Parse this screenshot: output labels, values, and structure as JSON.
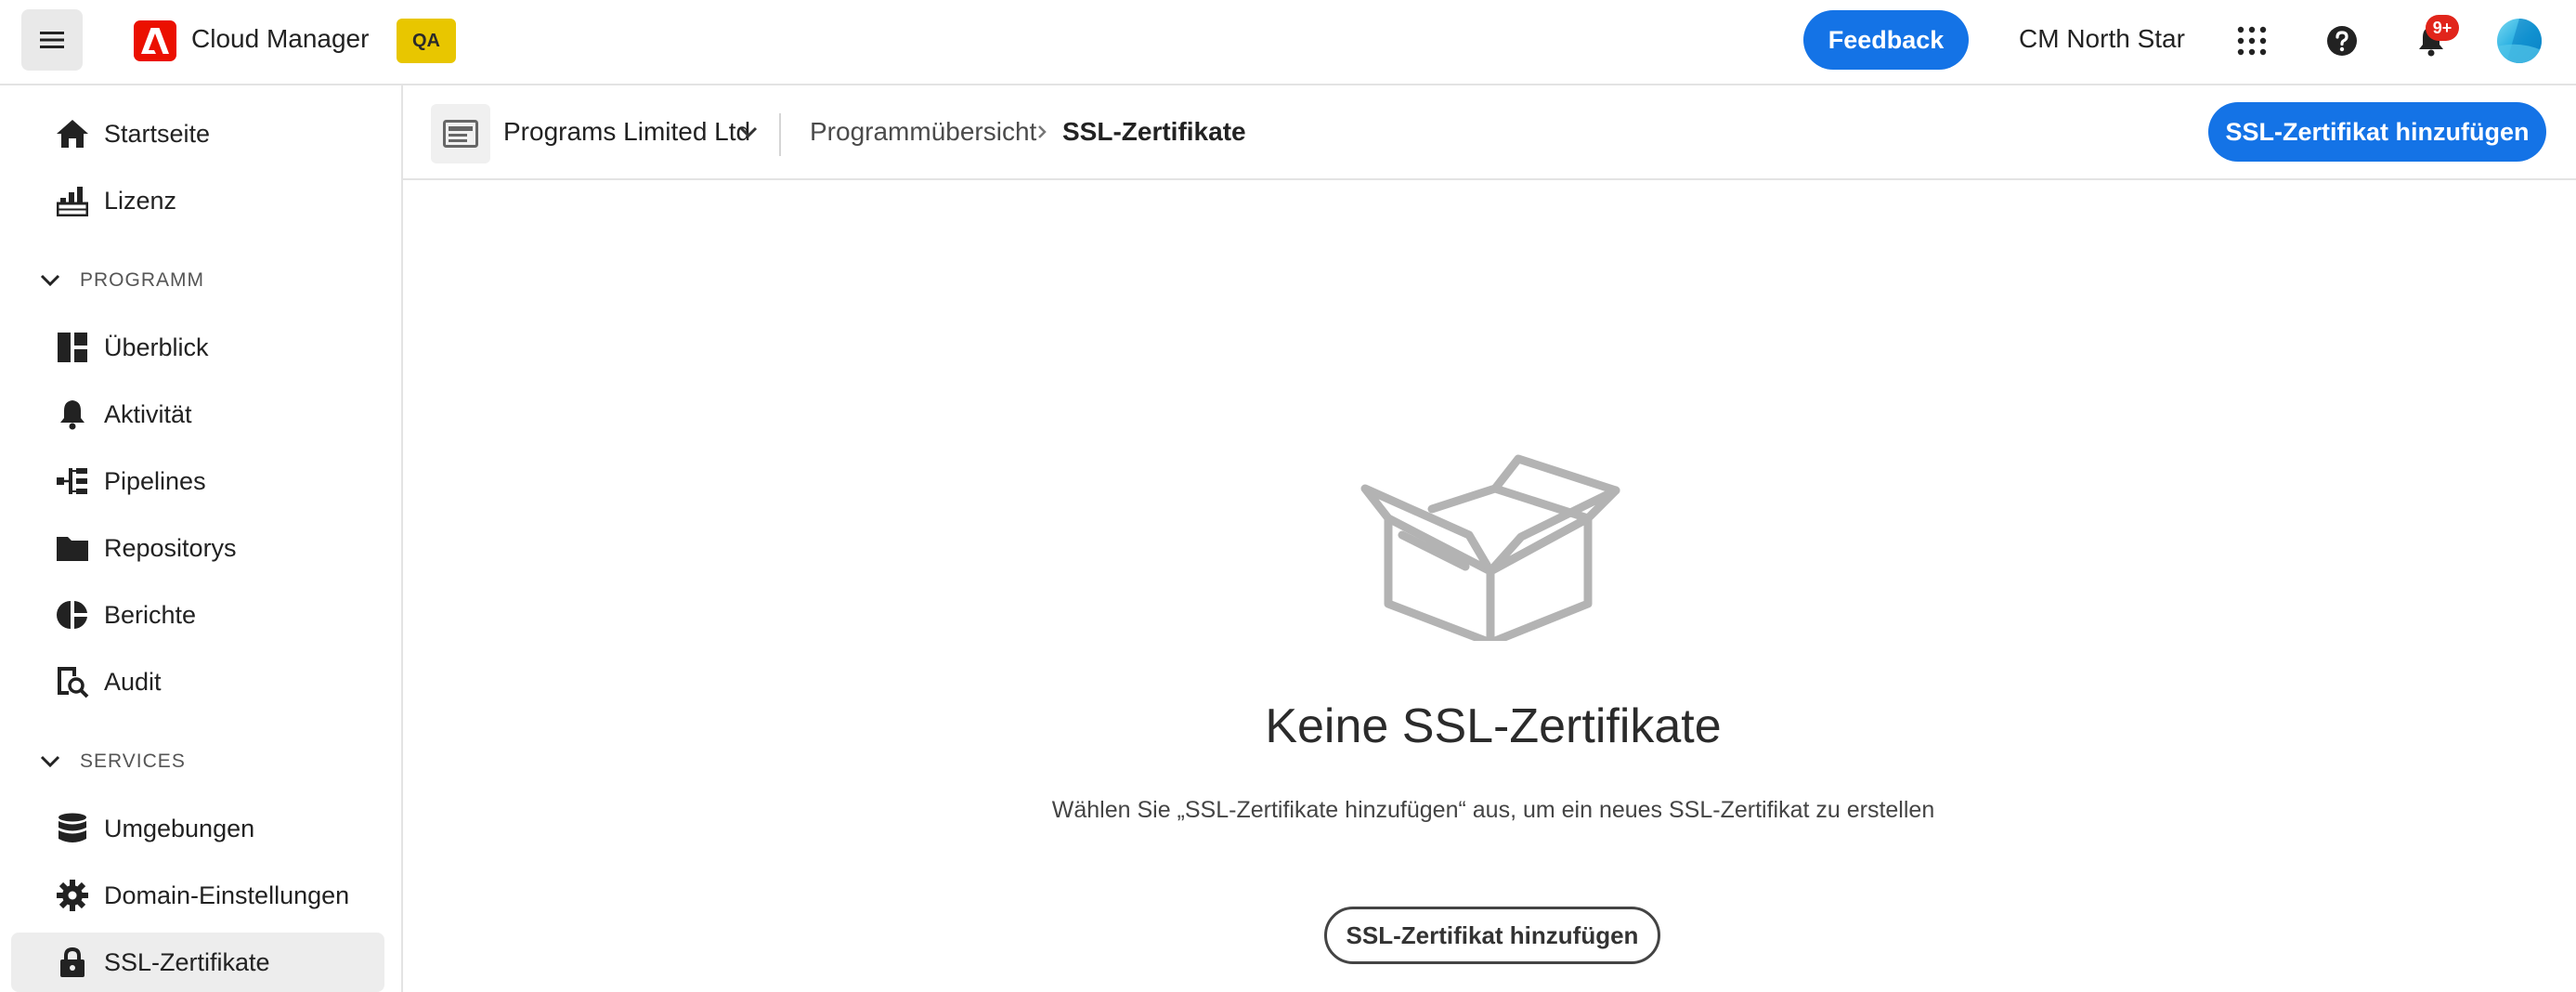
{
  "header": {
    "app_name": "Cloud Manager",
    "env_badge": "QA",
    "feedback_label": "Feedback",
    "org_name": "CM North Star",
    "notification_count": "9+"
  },
  "sidebar": {
    "top_items": [
      {
        "label": "Startseite",
        "icon": "home-icon"
      },
      {
        "label": "Lizenz",
        "icon": "license-chart-icon"
      }
    ],
    "program_section": {
      "label": "PROGRAMM",
      "items": [
        {
          "label": "Überblick",
          "icon": "dashboard-icon"
        },
        {
          "label": "Aktivität",
          "icon": "bell-icon"
        },
        {
          "label": "Pipelines",
          "icon": "pipeline-icon"
        },
        {
          "label": "Repositorys",
          "icon": "folder-icon"
        },
        {
          "label": "Berichte",
          "icon": "pie-chart-icon"
        },
        {
          "label": "Audit",
          "icon": "audit-search-icon"
        }
      ]
    },
    "services_section": {
      "label": "SERVICES",
      "items": [
        {
          "label": "Umgebungen",
          "icon": "database-icon"
        },
        {
          "label": "Domain-Einstellungen",
          "icon": "gear-icon"
        },
        {
          "label": "SSL-Zertifikate",
          "icon": "lock-icon",
          "active": true
        }
      ]
    }
  },
  "subheader": {
    "program_name": "Programs Limited Ltd",
    "breadcrumb": [
      "Programmübersicht",
      "SSL-Zertifikate"
    ],
    "add_button_label": "SSL-Zertifikat hinzufügen"
  },
  "empty_state": {
    "title": "Keine SSL-Zertifikate",
    "description": "Wählen Sie „SSL-Zertifikate hinzufügen“ aus, um ein neues SSL-Zertifikat zu erstellen",
    "button_label": "SSL-Zertifikat hinzufügen",
    "illustration_icon": "empty-box-icon"
  },
  "colors": {
    "accent": "#1473e6",
    "adobe_red": "#eb1000",
    "env_badge": "#e8c600",
    "notification": "#e1251b"
  }
}
